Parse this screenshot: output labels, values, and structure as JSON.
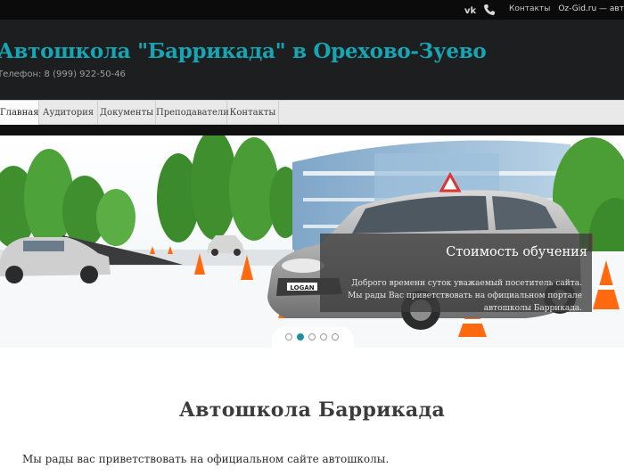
{
  "topbar": {
    "social_icons": [
      "vk-icon",
      "phone-icon"
    ],
    "contacts_link": "Контакты",
    "site_link": "Oz-Gid.ru — автошкол"
  },
  "header": {
    "title": "Автошкола \"Баррикада\" в Орехово-Зуево",
    "phone": "Телефон: 8 (999) 922-50-46"
  },
  "nav": {
    "items": [
      {
        "label": "Главная",
        "active": true
      },
      {
        "label": "Аудитория",
        "active": false
      },
      {
        "label": "Документы",
        "active": false
      },
      {
        "label": "Преподаватели",
        "active": false
      },
      {
        "label": "Контакты",
        "active": false
      }
    ]
  },
  "slider": {
    "caption_title": "Стоимость обучения",
    "caption_text": "Доброго времени суток уважаемый посетитель сайта. Мы рады Вас приветствовать на официальном портале автошколы Баррикада.",
    "car_plate": "LOGAN",
    "dots_count": 5,
    "active_dot": 2
  },
  "main": {
    "heading": "Автошкола Баррикада",
    "intro": "Мы рады вас приветствовать на официальном сайте автошколы."
  },
  "colors": {
    "accent": "#17a4b3",
    "header_bg": "#1d1e1f",
    "nav_bg": "#e9e9e9"
  }
}
